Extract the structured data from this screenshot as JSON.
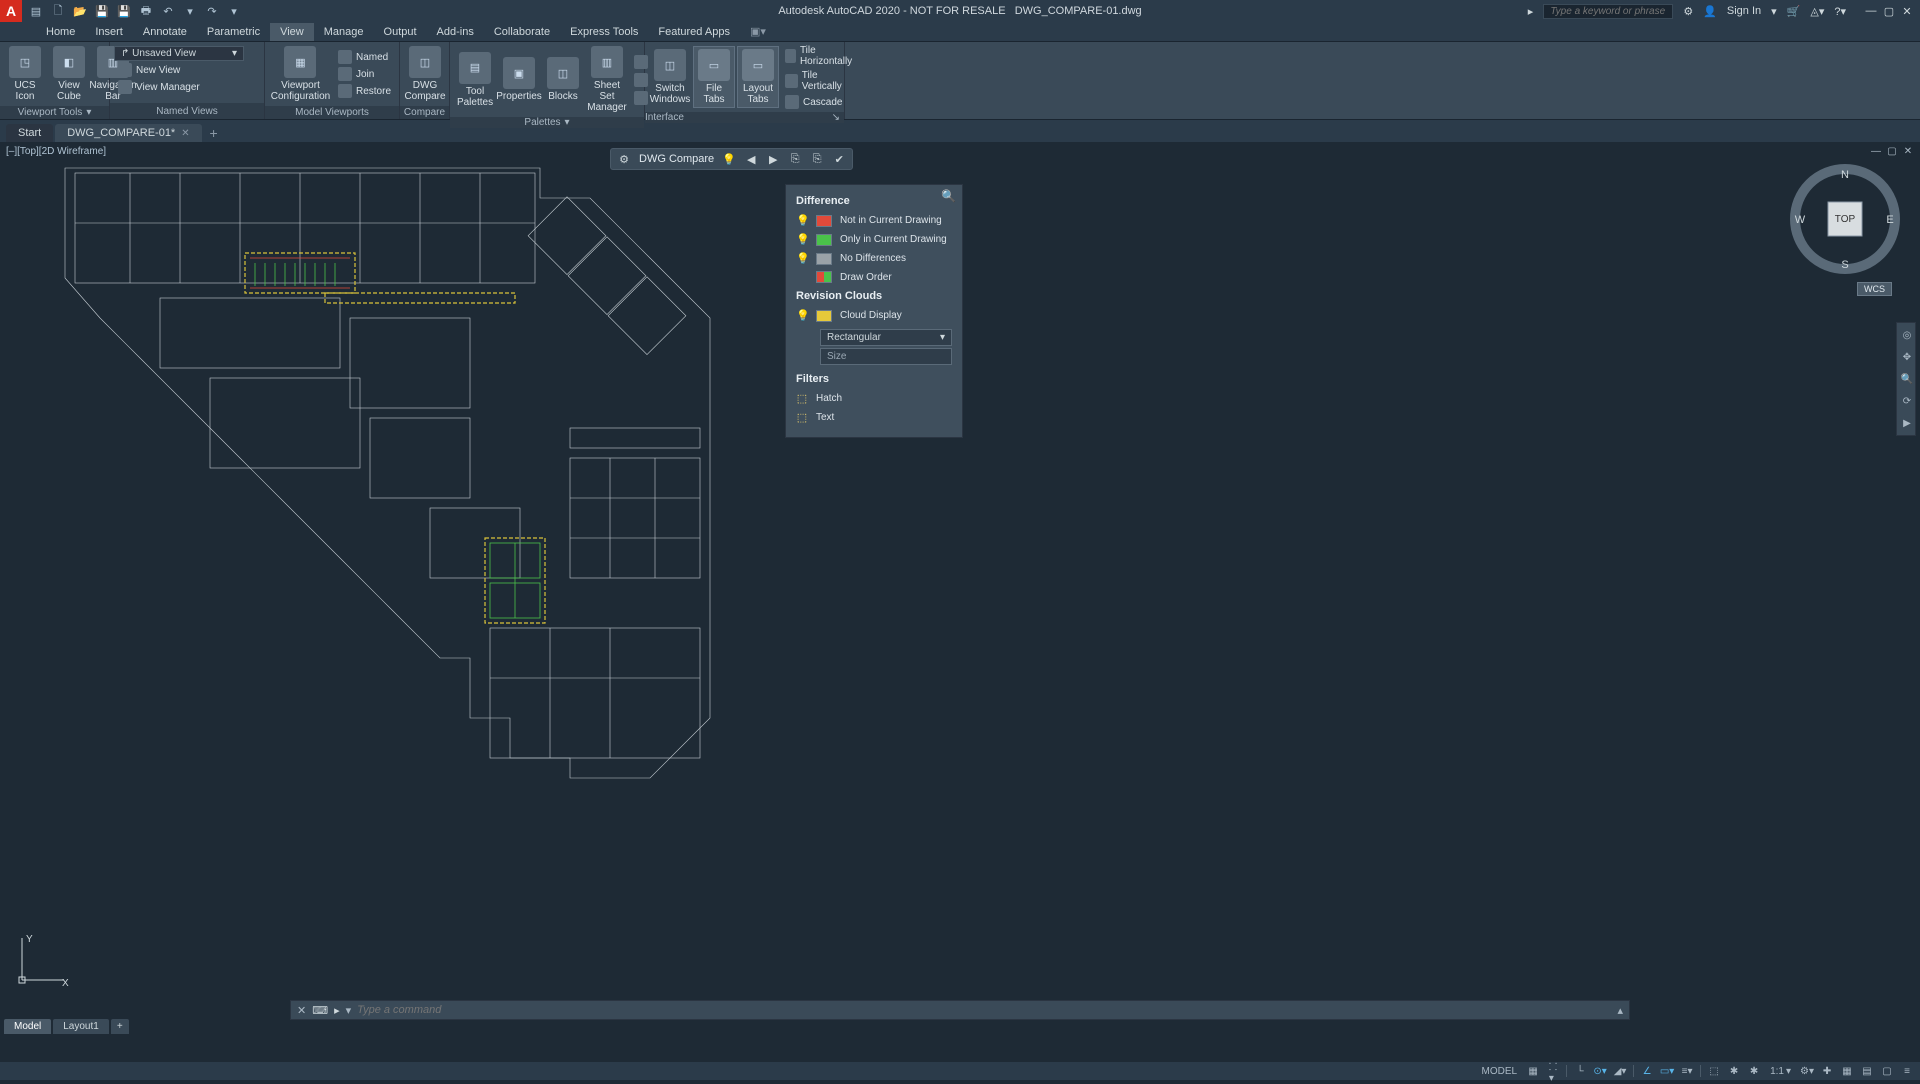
{
  "title": {
    "app": "Autodesk AutoCAD 2020 - NOT FOR RESALE",
    "file": "DWG_COMPARE-01.dwg"
  },
  "search_placeholder": "Type a keyword or phrase",
  "signin": "Sign In",
  "menu": [
    "Home",
    "Insert",
    "Annotate",
    "Parametric",
    "View",
    "Manage",
    "Output",
    "Add-ins",
    "Collaborate",
    "Express Tools",
    "Featured Apps"
  ],
  "menu_active_index": 4,
  "ribbon": {
    "viewport_tools": {
      "title": "Viewport Tools",
      "ucs": "UCS Icon",
      "cube": "View Cube",
      "navbar": "Navigation Bar"
    },
    "named_views": {
      "title": "Named Views",
      "unsaved": "Unsaved View",
      "new": "New View",
      "mgr": "View Manager"
    },
    "model_viewports": {
      "title": "Model Viewports",
      "config": "Viewport Configuration",
      "named": "Named",
      "join": "Join",
      "restore": "Restore"
    },
    "compare": {
      "title": "Compare",
      "btn": "DWG Compare"
    },
    "palettes": {
      "title": "Palettes",
      "tool": "Tool Palettes",
      "props": "Properties",
      "blocks": "Blocks",
      "sheet": "Sheet Set Manager"
    },
    "interface": {
      "title": "Interface",
      "switch": "Switch Windows",
      "ftabs": "File Tabs",
      "ltabs": "Layout Tabs",
      "tileh": "Tile Horizontally",
      "tilev": "Tile Vertically",
      "cascade": "Cascade"
    }
  },
  "filetabs": {
    "start": "Start",
    "doc": "DWG_COMPARE-01*"
  },
  "vp_label": "[–][Top][2D Wireframe]",
  "cmp_toolbar": {
    "title": "DWG Compare"
  },
  "cmp_palette": {
    "difference": "Difference",
    "not_in": "Not in Current Drawing",
    "only_in": "Only in Current Drawing",
    "no_diff": "No Differences",
    "draw_order": "Draw Order",
    "rev_clouds": "Revision Clouds",
    "cloud_disp": "Cloud Display",
    "shape": "Rectangular",
    "size": "Size",
    "filters": "Filters",
    "hatch": "Hatch",
    "text": "Text",
    "colors": {
      "red": "#e24a3a",
      "green": "#4ac24a",
      "grey": "#9aa2a8",
      "cloud": "#e6c93a"
    }
  },
  "viewcube": {
    "top": "TOP",
    "n": "N",
    "s": "S",
    "e": "E",
    "w": "W"
  },
  "wcs": "WCS",
  "cmd_placeholder": "Type a command",
  "modeltabs": {
    "model": "Model",
    "layout1": "Layout1"
  },
  "statusbar": {
    "model": "MODEL",
    "scale": "1:1"
  }
}
